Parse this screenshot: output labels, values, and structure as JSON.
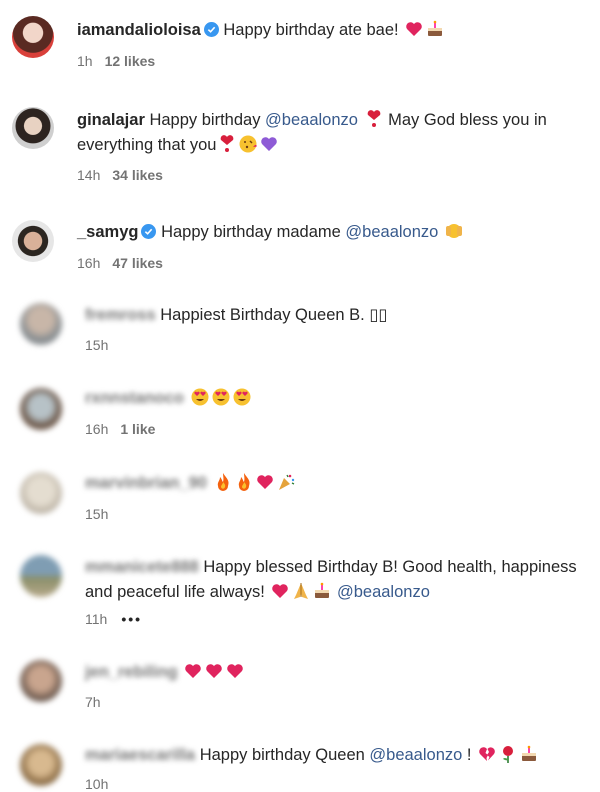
{
  "comments": [
    {
      "username": "iamandalioloisa",
      "verified": true,
      "text": "Happy birthday ate bae!",
      "emojis": [
        "red-heart",
        "birthday-cake"
      ],
      "time": "1h",
      "likes": "12 likes"
    },
    {
      "username": "ginalajar",
      "text_before": "Happy birthday",
      "mention": "@beaalonzo",
      "text_after": "May God bless you in everything that you",
      "emojis_mid": [
        "heart-exclamation"
      ],
      "emojis": [
        "heart-exclamation",
        "face-blowing-kiss",
        "purple-heart"
      ],
      "time": "14h",
      "likes": "34 likes"
    },
    {
      "username": "_samyg",
      "verified": true,
      "text": "Happy birthday madame",
      "mention": "@beaalonzo",
      "emojis": [
        "raising-hands"
      ],
      "time": "16h",
      "likes": "47 likes"
    },
    {
      "username": "fremross",
      "text": "Happiest Birthday Queen B. ▯▯",
      "time": "15h"
    },
    {
      "username": "rxnnstanoco",
      "emojis": [
        "heart-eyes",
        "heart-eyes",
        "heart-eyes"
      ],
      "time": "16h",
      "likes": "1 like"
    },
    {
      "username": "marvinbrian_90",
      "emojis": [
        "fire",
        "fire",
        "red-heart",
        "party-popper"
      ],
      "time": "15h"
    },
    {
      "username": "mmanicete888",
      "text": "Happy blessed Birthday B! Good health, happiness and peaceful life always!",
      "emojis": [
        "red-heart",
        "folded-hands",
        "birthday-cake"
      ],
      "mention": "@beaalonzo",
      "time": "11h",
      "more": "•••"
    },
    {
      "username": "jen_rebiling",
      "emojis": [
        "red-heart",
        "red-heart",
        "red-heart"
      ],
      "time": "7h"
    },
    {
      "username": "mariaescarilla",
      "text": "Happy birthday Queen",
      "mention": "@beaalonzo",
      "text_after": "!",
      "emojis": [
        "broken-heart",
        "rose",
        "birthday-cake"
      ],
      "time": "10h"
    }
  ],
  "colors": {
    "text": "#262626",
    "meta": "#737373",
    "mention": "#385a8c",
    "verified": "#3897f0",
    "heart": "#e0245e"
  }
}
